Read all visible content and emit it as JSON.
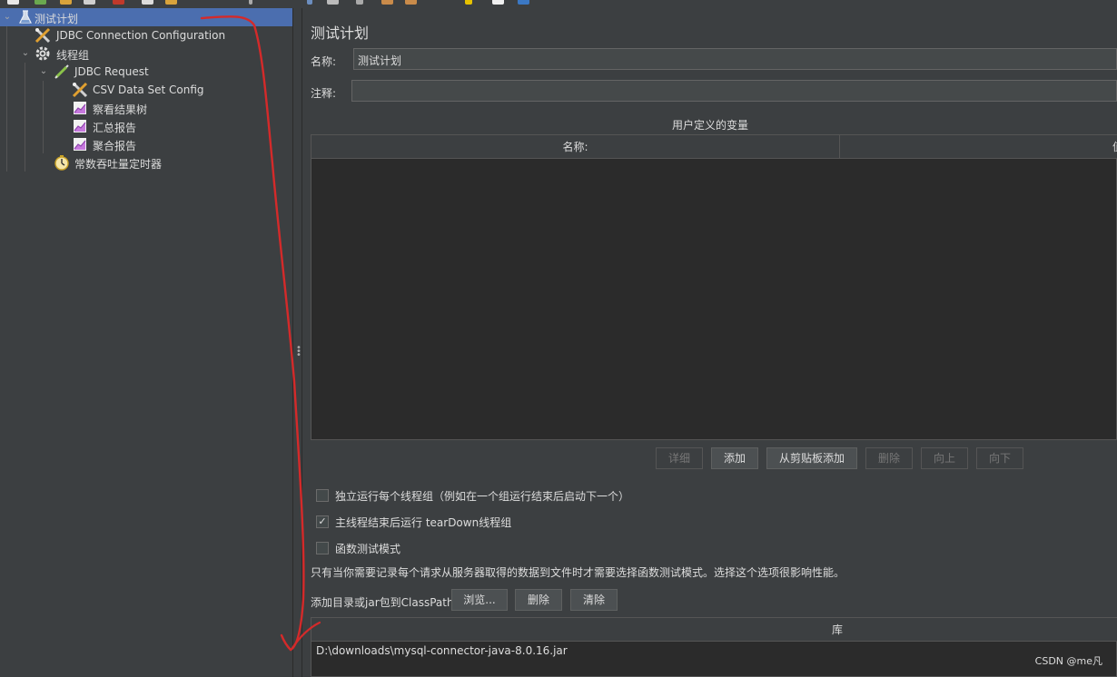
{
  "tree": {
    "items": [
      {
        "label": "测试计划",
        "icon": "test-plan-icon"
      },
      {
        "label": "JDBC Connection Configuration",
        "icon": "config-tools-icon"
      },
      {
        "label": "线程组",
        "icon": "gear-icon"
      },
      {
        "label": "JDBC Request",
        "icon": "sampler-pen-icon"
      },
      {
        "label": "CSV Data Set Config",
        "icon": "config-tools-icon"
      },
      {
        "label": "察看结果树",
        "icon": "listener-graph-icon"
      },
      {
        "label": "汇总报告",
        "icon": "listener-graph-icon"
      },
      {
        "label": "聚合报告",
        "icon": "listener-graph-icon"
      },
      {
        "label": "常数吞吐量定时器",
        "icon": "timer-stopwatch-icon"
      }
    ]
  },
  "panel": {
    "title": "测试计划",
    "name_label": "名称:",
    "name_value": "测试计划",
    "comment_label": "注释:",
    "comment_value": ""
  },
  "variables": {
    "caption": "用户定义的变量",
    "col_name": "名称:",
    "col_value": "值",
    "buttons": {
      "detail": "详细",
      "add": "添加",
      "add_clipboard": "从剪贴板添加",
      "delete": "删除",
      "up": "向上",
      "down": "向下"
    }
  },
  "options": {
    "run_independent": {
      "label": "独立运行每个线程组（例如在一个组运行结束后启动下一个）",
      "checked": false
    },
    "teardown": {
      "label": "主线程结束后运行 tearDown线程组",
      "checked": true
    },
    "functional_mode": {
      "label": "函数测试模式",
      "checked": false
    },
    "functional_note": "只有当你需要记录每个请求从服务器取得的数据到文件时才需要选择函数测试模式。选择这个选项很影响性能。"
  },
  "classpath": {
    "label": "添加目录或jar包到ClassPath",
    "browse": "浏览...",
    "delete": "删除",
    "clear": "清除",
    "col_library": "库",
    "rows": [
      "D:\\downloads\\mysql-connector-java-8.0.16.jar"
    ]
  },
  "colors": {
    "selection": "#4b6eaf",
    "annotation": "#d42a2a"
  },
  "watermark": "CSDN @me凡"
}
